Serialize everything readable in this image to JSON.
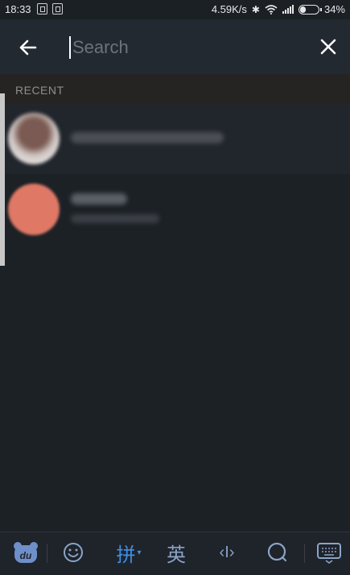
{
  "status_bar": {
    "time": "18:33",
    "network_speed": "4.59K/s",
    "battery_percent": "34%",
    "battery_level": 0.34
  },
  "search": {
    "placeholder": "Search",
    "value": ""
  },
  "recent": {
    "label": "RECENT",
    "items": [
      {
        "name": "",
        "subtitle": ""
      },
      {
        "name": "",
        "subtitle": ""
      }
    ]
  },
  "keyboard_toolbar": {
    "pinyin_label": "拼",
    "english_label": "英",
    "cursor_label": "‹I›"
  },
  "colors": {
    "accent": "#3d8fe6",
    "avatar_orange": "#df7966",
    "background": "#1c2126"
  }
}
